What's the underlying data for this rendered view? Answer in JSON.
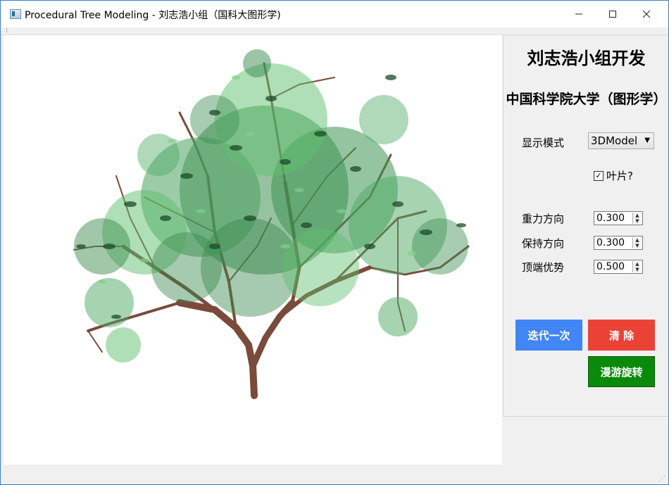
{
  "window": {
    "title": "Procedural Tree Modeling - 刘志浩小组（国科大图形学)",
    "minimize_icon": "minimize-icon",
    "maximize_icon": "maximize-icon",
    "close_icon": "close-icon"
  },
  "panel": {
    "heading": "刘志浩小组开发",
    "subheading": "中国科学院大学（图形学）",
    "display_mode_label": "显示模式",
    "display_mode_value": "3DModel",
    "leaves_label": "叶片?",
    "leaves_checked": true,
    "gravity_label": "重力方向",
    "gravity_value": "0.300",
    "keep_direction_label": "保持方向",
    "keep_direction_value": "0.300",
    "apical_label": "顶端优势",
    "apical_value": "0.500",
    "iterate_button": "迭代一次",
    "clear_button": "清 除",
    "orbit_button": "漫游旋转"
  },
  "colors": {
    "iterate": "#4285f4",
    "clear": "#ea4335",
    "orbit": "#0a8a0a",
    "leaf_light": "#5fbf6e",
    "leaf_dark": "#1d4a2a",
    "bark": "#7a4a3a"
  }
}
